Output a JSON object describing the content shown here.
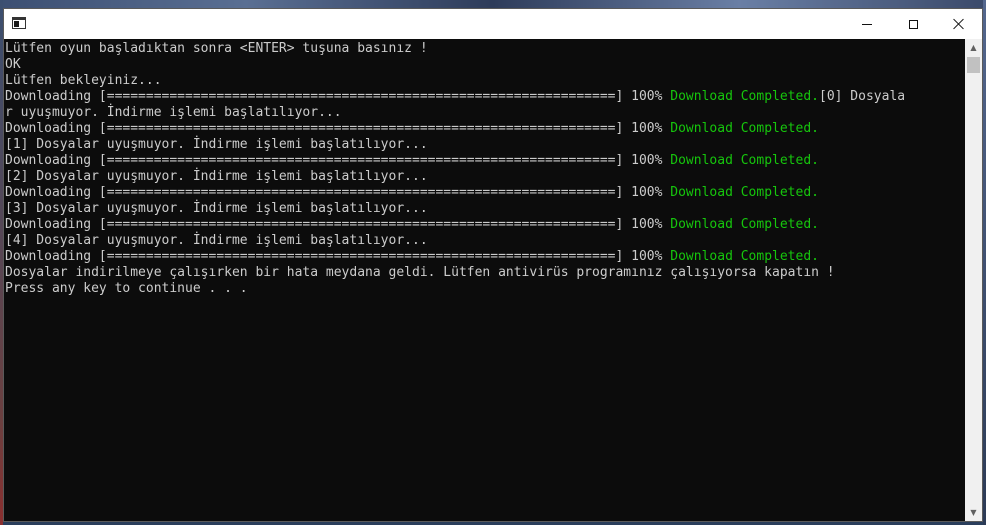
{
  "window": {
    "title": "",
    "controls": {
      "minimize_icon": "minimize-icon",
      "maximize_icon": "maximize-icon",
      "close_icon": "close-icon"
    }
  },
  "console": {
    "colors": {
      "background": "#0c0c0c",
      "text": "#cccccc",
      "success": "#16c60c"
    },
    "lines": [
      [
        {
          "text": "Lütfen oyun başladıktan sonra <ENTER> tuşuna basınız !"
        }
      ],
      [
        {
          "text": "OK"
        }
      ],
      [
        {
          "text": "Lütfen bekleyiniz..."
        }
      ],
      [
        {
          "text": "Downloading [=================================================================] 100% "
        },
        {
          "text": "Download Completed.",
          "style": "green"
        },
        {
          "text": "[0] Dosyala"
        }
      ],
      [
        {
          "text": "r uyuşmuyor. İndirme işlemi başlatılıyor..."
        }
      ],
      [
        {
          "text": "Downloading [=================================================================] 100% "
        },
        {
          "text": "Download Completed.",
          "style": "green"
        }
      ],
      [
        {
          "text": "[1] Dosyalar uyuşmuyor. İndirme işlemi başlatılıyor..."
        }
      ],
      [
        {
          "text": "Downloading [=================================================================] 100% "
        },
        {
          "text": "Download Completed.",
          "style": "green"
        }
      ],
      [
        {
          "text": "[2] Dosyalar uyuşmuyor. İndirme işlemi başlatılıyor..."
        }
      ],
      [
        {
          "text": "Downloading [=================================================================] 100% "
        },
        {
          "text": "Download Completed.",
          "style": "green"
        }
      ],
      [
        {
          "text": "[3] Dosyalar uyuşmuyor. İndirme işlemi başlatılıyor..."
        }
      ],
      [
        {
          "text": "Downloading [=================================================================] 100% "
        },
        {
          "text": "Download Completed.",
          "style": "green"
        }
      ],
      [
        {
          "text": "[4] Dosyalar uyuşmuyor. İndirme işlemi başlatılıyor..."
        }
      ],
      [
        {
          "text": "Downloading [=================================================================] 100% "
        },
        {
          "text": "Download Completed.",
          "style": "green"
        }
      ],
      [
        {
          "text": "Dosyalar indirilmeye çalışırken bir hata meydana geldi. Lütfen antivirüs programınız çalışıyorsa kapatın !"
        }
      ],
      [
        {
          "text": "Press any key to continue . . ."
        }
      ]
    ]
  },
  "scrollbar": {
    "up_icon": "scroll-up-arrow-icon",
    "down_icon": "scroll-down-arrow-icon"
  }
}
